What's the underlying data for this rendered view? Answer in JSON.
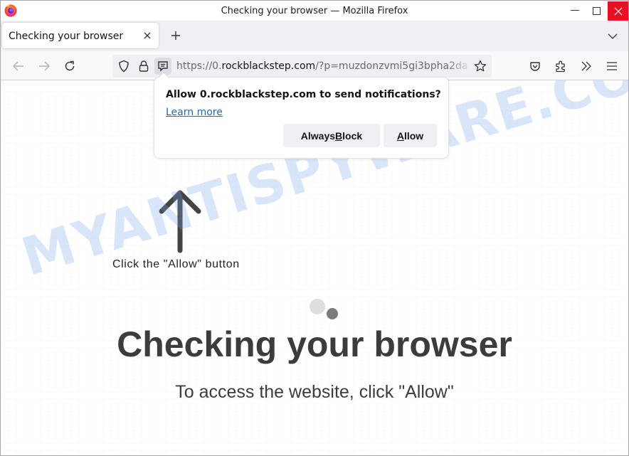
{
  "window": {
    "title": "Checking your browser — Mozilla Firefox",
    "controls": {
      "minimize": "minimize",
      "maximize": "maximize",
      "close": "close"
    }
  },
  "tabs": [
    {
      "label": "Checking your browser",
      "active": true
    }
  ],
  "navbar": {
    "url_scheme": "https://0.",
    "url_domain": "rockblackstep.com",
    "url_path": "/?p=muzdonzvmi5gi3bpha2da",
    "icons": [
      "back-icon",
      "forward-icon",
      "reload-icon",
      "tracking-protection-shield-icon",
      "lock-icon",
      "notification-permission-icon",
      "bookmark-star-icon",
      "pocket-icon",
      "extensions-icon",
      "overflow-chevrons-icon",
      "menu-hamburger-icon"
    ]
  },
  "notification_popup": {
    "title": "Allow 0.rockblackstep.com to send notifications?",
    "learn_more": "Learn more",
    "block_button": {
      "pre": "Always ",
      "accesskey": "B",
      "post": "lock"
    },
    "allow_button": {
      "pre": "",
      "accesskey": "A",
      "post": "llow"
    }
  },
  "page": {
    "hint": "Click the \"Allow\" button",
    "headline": "Checking your browser",
    "subline": "To access the website, click \"Allow\"",
    "watermark": "MYANTISPYWARE.COM"
  },
  "colors": {
    "close_button_red": "#e81123",
    "tabstrip_bg": "#f0f0f4",
    "headline_text": "#3c3c3c",
    "link": "#2a6aa6",
    "watermark": "#78a5eb"
  }
}
